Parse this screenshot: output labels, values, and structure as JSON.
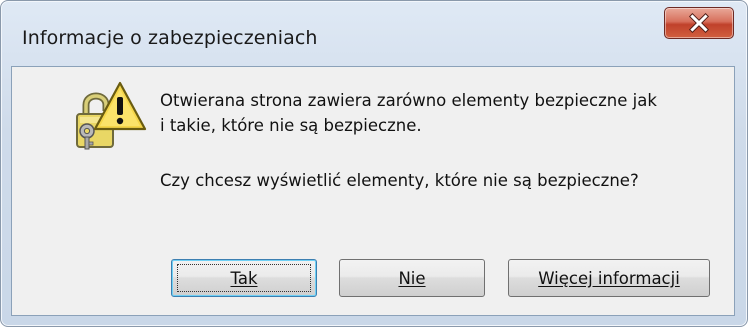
{
  "window": {
    "title": "Informacje o zabezpieczeniach"
  },
  "titlebar": {
    "close_icon": "close-x-icon"
  },
  "message": {
    "line1": "Otwierana strona zawiera zarówno elementy bezpieczne jak",
    "line2": "i takie, które nie są bezpieczne.",
    "question": "Czy chcesz wyświetlić elementy, które nie są bezpieczne?"
  },
  "icon": {
    "name": "security-warning-lock-icon"
  },
  "buttons": {
    "yes": "Tak",
    "no": "Nie",
    "more": "Więcej informacji"
  },
  "colors": {
    "close_button": "#c9503a",
    "client_background": "#f0f0f0",
    "focus_border": "#3c7fb1",
    "warning_yellow": "#f5d64a"
  }
}
